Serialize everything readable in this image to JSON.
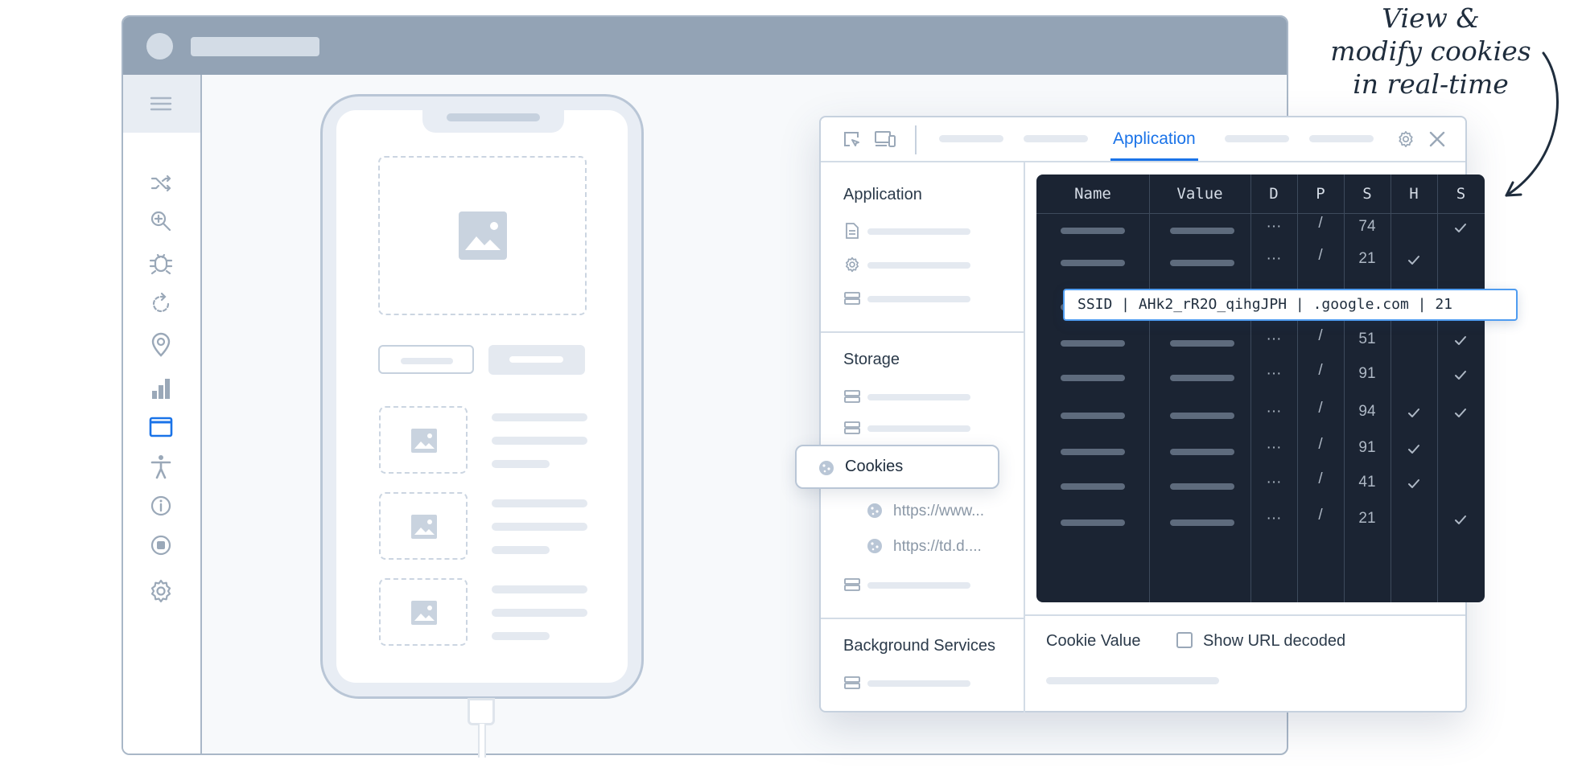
{
  "devtools": {
    "active_tab": "Application",
    "sidebar": {
      "application_heading": "Application",
      "storage_heading": "Storage",
      "cookies_label": "Cookies",
      "cookie_urls": [
        "https://www...",
        "https://td.d...."
      ],
      "background_heading": "Background Services"
    },
    "cookie_table": {
      "columns": [
        "Name",
        "Value",
        "D",
        "P",
        "S",
        "H",
        "S"
      ],
      "rows": [
        {
          "domain": "···",
          "path": "/",
          "size": "74",
          "httponly": false,
          "secure": true
        },
        {
          "domain": "···",
          "path": "/",
          "size": "21",
          "httponly": true,
          "secure": false
        },
        {
          "domain": "···",
          "path": "/",
          "size": "21",
          "httponly": true,
          "secure": true
        },
        {
          "domain": "···",
          "path": "/",
          "size": "51",
          "httponly": false,
          "secure": true
        },
        {
          "domain": "···",
          "path": "/",
          "size": "91",
          "httponly": false,
          "secure": true
        },
        {
          "domain": "···",
          "path": "/",
          "size": "94",
          "httponly": true,
          "secure": true
        },
        {
          "domain": "···",
          "path": "/",
          "size": "91",
          "httponly": true,
          "secure": false
        },
        {
          "domain": "···",
          "path": "/",
          "size": "41",
          "httponly": true,
          "secure": false
        },
        {
          "domain": "···",
          "path": "/",
          "size": "21",
          "httponly": false,
          "secure": true
        }
      ],
      "tooltip": "SSID | AHk2_rR2O_qihgJPH | .google.com | 21"
    },
    "footer": {
      "cookie_value_label": "Cookie Value",
      "show_url_decoded_label": "Show URL decoded"
    }
  },
  "annotation": {
    "lines": [
      "View &",
      "modify cookies",
      "in real-time"
    ]
  },
  "colors": {
    "accent": "#1a73e8",
    "table_bg": "#1b2433",
    "frame": "#93a3b5"
  }
}
